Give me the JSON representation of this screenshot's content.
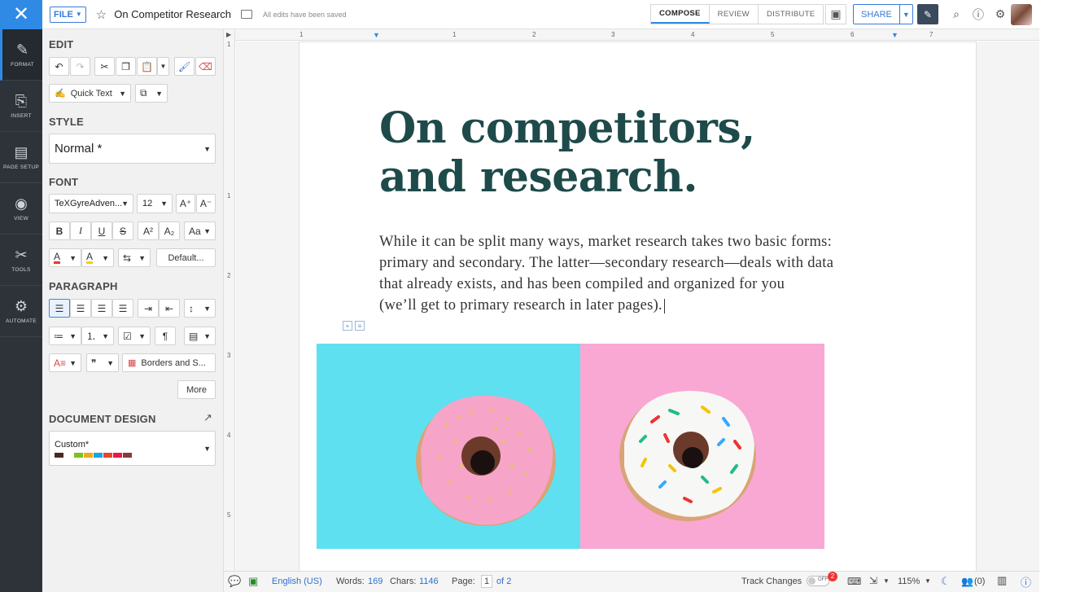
{
  "topbar": {
    "file_label": "FILE",
    "doc_title": "On Competitor Research",
    "saved_status": "All edits have been saved",
    "tabs": [
      "COMPOSE",
      "REVIEW",
      "DISTRIBUTE"
    ],
    "share_label": "SHARE"
  },
  "rail": {
    "items": [
      {
        "label": "FORMAT",
        "icon": "pen-icon"
      },
      {
        "label": "INSERT",
        "icon": "insert-icon"
      },
      {
        "label": "PAGE SETUP",
        "icon": "page-setup-icon"
      },
      {
        "label": "VIEW",
        "icon": "eye-icon"
      },
      {
        "label": "TOOLS",
        "icon": "tools-icon"
      },
      {
        "label": "AUTOMATE",
        "icon": "automate-icon"
      }
    ]
  },
  "panel": {
    "edit_heading": "EDIT",
    "quick_text": "Quick Text",
    "style_heading": "STYLE",
    "style_value": "Normal *",
    "font_heading": "FONT",
    "font_family": "TeXGyreAdven...",
    "font_size": "12",
    "default_btn": "Default...",
    "paragraph_heading": "PARAGRAPH",
    "borders_btn": "Borders and S...",
    "more_btn": "More",
    "doc_design_heading": "DOCUMENT DESIGN",
    "doc_design_value": "Custom*",
    "palette": [
      "#4a2a22",
      "#7ac21f",
      "#f0a81c",
      "#17a6df",
      "#e8452a",
      "#e31b4b",
      "#8a3a3a"
    ]
  },
  "document": {
    "heading_line1": "On competitors,",
    "heading_line2": "and research.",
    "paragraph_lines": [
      "While it can be split many ways, market research takes two basic forms:",
      "primary and secondary. The latter—secondary research—deals with data",
      "that already exists, and has been compiled and organized for you",
      "(we’ll get to primary research in later pages)."
    ]
  },
  "ruler": {
    "top_numbers": [
      "1",
      "1",
      "2",
      "3",
      "4",
      "5",
      "6",
      "7"
    ],
    "left_numbers": [
      "1",
      "1",
      "2",
      "3",
      "4",
      "5"
    ]
  },
  "status": {
    "language": "English (US)",
    "words_label": "Words:",
    "words": "169",
    "chars_label": "Chars:",
    "chars": "1146",
    "page_label": "Page:",
    "page_num": "1",
    "page_of": "of 2",
    "track_changes": "Track Changes",
    "toggle_state": "OFF",
    "notif_count": "2",
    "zoom": "115%",
    "collaborators": "(0)"
  },
  "colors": {
    "accent": "#2f8ae5",
    "rail_bg": "#2d3339",
    "heading_color": "#1e4a4a",
    "photo_left": "#5fe0f0",
    "photo_right": "#f9a8d4"
  }
}
